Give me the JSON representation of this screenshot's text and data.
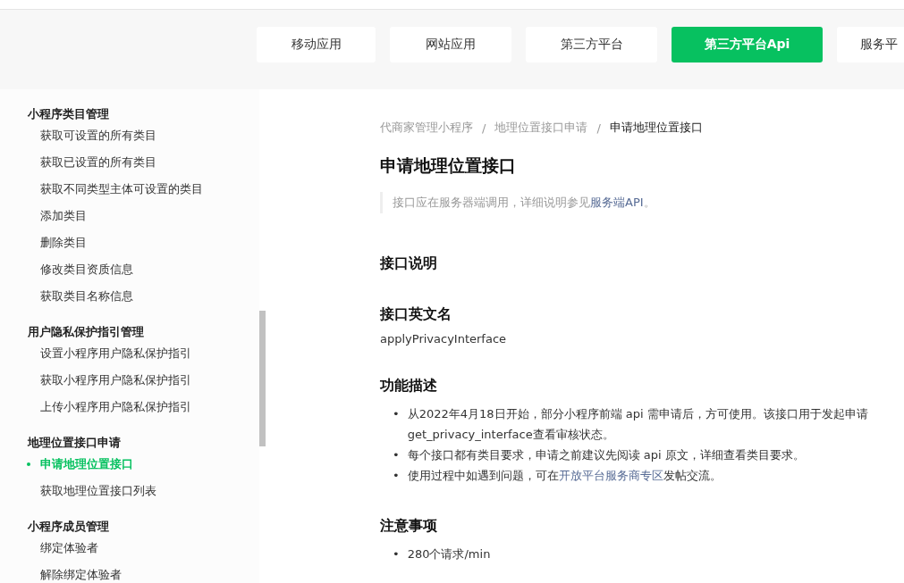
{
  "top_nav": {
    "tabs": [
      {
        "label": "移动应用",
        "selected": false
      },
      {
        "label": "网站应用",
        "selected": false
      },
      {
        "label": "第三方平台",
        "selected": false
      },
      {
        "label": "第三方平台Api",
        "selected": true
      },
      {
        "label": "服务平",
        "selected": false
      }
    ]
  },
  "sidebar": {
    "groups": [
      {
        "title": "小程序类目管理",
        "items": [
          {
            "label": "获取可设置的所有类目",
            "selected": false
          },
          {
            "label": "获取已设置的所有类目",
            "selected": false
          },
          {
            "label": "获取不同类型主体可设置的类目",
            "selected": false
          },
          {
            "label": "添加类目",
            "selected": false
          },
          {
            "label": "删除类目",
            "selected": false
          },
          {
            "label": "修改类目资质信息",
            "selected": false
          },
          {
            "label": "获取类目名称信息",
            "selected": false
          }
        ]
      },
      {
        "title": "用户隐私保护指引管理",
        "items": [
          {
            "label": "设置小程序用户隐私保护指引",
            "selected": false
          },
          {
            "label": "获取小程序用户隐私保护指引",
            "selected": false
          },
          {
            "label": "上传小程序用户隐私保护指引",
            "selected": false
          }
        ]
      },
      {
        "title": "地理位置接口申请",
        "items": [
          {
            "label": "申请地理位置接口",
            "selected": true
          },
          {
            "label": "获取地理位置接口列表",
            "selected": false
          }
        ]
      },
      {
        "title": "小程序成员管理",
        "items": [
          {
            "label": "绑定体验者",
            "selected": false
          },
          {
            "label": "解除绑定体验者",
            "selected": false
          }
        ]
      }
    ]
  },
  "breadcrumb": [
    "代商家管理小程序",
    "地理位置接口申请",
    "申请地理位置接口"
  ],
  "breadcrumb_separator": "/",
  "bullet_marker": "•",
  "title": "申请地理位置接口",
  "note": {
    "text": "接口应在服务器端调用，详细说明参见",
    "link": "服务端API",
    "end": "。"
  },
  "sections": [
    {
      "heading": "接口说明"
    },
    {
      "heading": "接口英文名",
      "paragraph": "applyPrivacyInterface"
    },
    {
      "heading": "功能描述",
      "bullets": [
        {
          "lines": [
            "从2022年4月18日开始，部分小程序前端 api 需申请后，方可使用。该接口用于发起申请",
            "get_privacy_interface查看审核状态。"
          ]
        },
        {
          "lines": [
            "每个接口都有类目要求，申请之前建议先阅读 api 原文，详细查看类目要求。"
          ]
        },
        {
          "lines": [
            "使用过程中如遇到问题，可在"
          ],
          "link": "开放平台服务商专区",
          "end": "发帖交流。"
        }
      ]
    },
    {
      "heading": "注意事项",
      "bullets": [
        {
          "lines": [
            "280个请求/min"
          ]
        }
      ]
    }
  ]
}
